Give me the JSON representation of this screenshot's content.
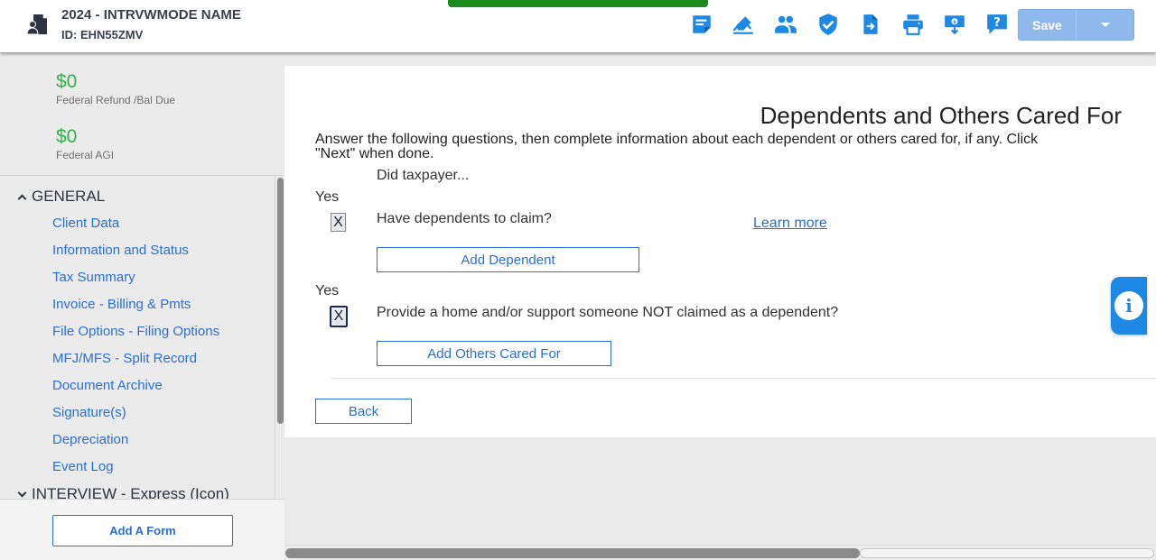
{
  "header": {
    "client_name": "2024 - INTRVWMODE NAME",
    "client_id": "ID: EHN55ZMV",
    "toolbar_icons": [
      "notes-icon",
      "signature-icon",
      "users-icon",
      "shield-check-icon",
      "document-transfer-icon",
      "print-icon",
      "refund-monitor-icon",
      "help-icon"
    ],
    "save_label": "Save",
    "accent_color": "#1e88e5"
  },
  "sidebar": {
    "refund_value": "$0",
    "refund_label": "Federal Refund /Bal Due",
    "agi_value": "$0",
    "agi_label": "Federal AGI",
    "sections": [
      {
        "label": "GENERAL",
        "items": [
          "Client Data",
          "Information and Status",
          "Tax Summary",
          "Invoice - Billing & Pmts",
          "File Options - Filing Options",
          "MFJ/MFS - Split Record",
          "Document Archive",
          "Signature(s)",
          "Depreciation",
          "Event Log"
        ]
      },
      {
        "label": "INTERVIEW - Express (Icon)"
      }
    ],
    "add_form_label": "Add A Form"
  },
  "main": {
    "title": "Dependents and Others Cared For",
    "intro": "Answer the following questions, then complete information about each dependent or others cared for, if any. Click \"Next\" when done.",
    "did_taxpayer": "Did taxpayer...",
    "questions": [
      {
        "yes_label": "Yes",
        "checkbox_value": "X",
        "text": "Have dependents to claim?",
        "button_label": "Add Dependent",
        "learn_more": "Learn more"
      },
      {
        "yes_label": "Yes",
        "checkbox_value": "X",
        "text": "Provide a home and/or support someone NOT claimed as a dependent?",
        "button_label": "Add Others Cared For"
      }
    ],
    "back_label": "Back"
  }
}
